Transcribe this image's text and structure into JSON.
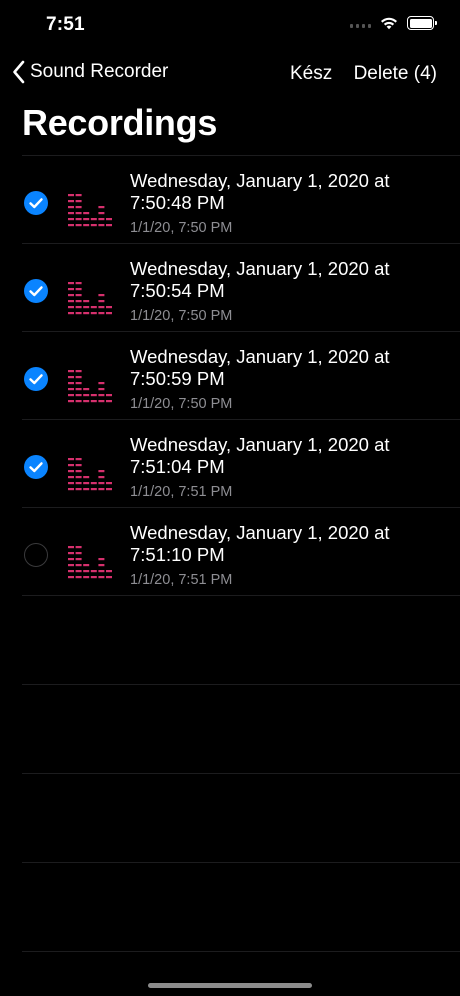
{
  "status": {
    "time": "7:51"
  },
  "nav": {
    "back_label": "Sound Recorder",
    "done_label": "Kész",
    "delete_label": "Delete (4)"
  },
  "page": {
    "title": "Recordings"
  },
  "colors": {
    "accent": "#0a84ff",
    "waveform": "#d6306d",
    "secondary_text": "#8e8e93"
  },
  "recordings": [
    {
      "title_line1": "Wednesday, January 1, 2020 at",
      "title_line2": "7:50:48 PM",
      "subtitle": "1/1/20, 7:50 PM",
      "selected": true
    },
    {
      "title_line1": "Wednesday, January 1, 2020 at",
      "title_line2": "7:50:54 PM",
      "subtitle": "1/1/20, 7:50 PM",
      "selected": true
    },
    {
      "title_line1": "Wednesday, January 1, 2020 at",
      "title_line2": "7:50:59 PM",
      "subtitle": "1/1/20, 7:50 PM",
      "selected": true
    },
    {
      "title_line1": "Wednesday, January 1, 2020 at",
      "title_line2": "7:51:04 PM",
      "subtitle": "1/1/20, 7:51 PM",
      "selected": true
    },
    {
      "title_line1": "Wednesday, January 1, 2020 at",
      "title_line2": "7:51:10 PM",
      "subtitle": "1/1/20, 7:51 PM",
      "selected": false
    }
  ]
}
